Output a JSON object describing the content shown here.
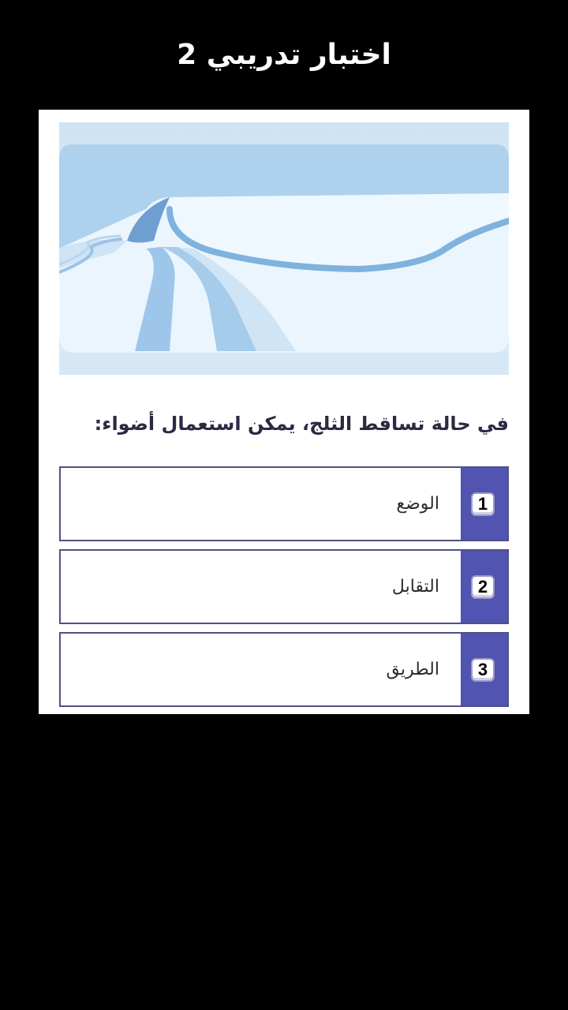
{
  "header": {
    "title": "اختبار تدريبي 2"
  },
  "question": {
    "text": "في حالة تساقط الثلج، يمكن استعمال أضواء:"
  },
  "options": [
    {
      "number": "1",
      "label": "الوضع"
    },
    {
      "number": "2",
      "label": "التقابل"
    },
    {
      "number": "3",
      "label": "الطريق"
    }
  ],
  "colors": {
    "background": "#000000",
    "card": "#ffffff",
    "option_border": "#505089",
    "number_cell": "#5154b0",
    "question_text": "#2a2a44"
  },
  "illustration": {
    "icon": "snowy-road-illustration"
  }
}
